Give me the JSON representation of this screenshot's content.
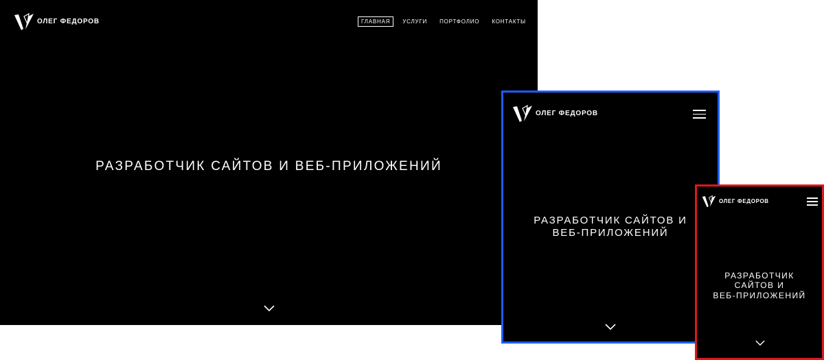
{
  "brand": {
    "name": "ОЛЕГ ФЕДОРОВ",
    "logo_icon": "logo-mark-icon"
  },
  "nav": {
    "items": [
      {
        "label": "ГЛАВНАЯ",
        "active": true
      },
      {
        "label": "УСЛУГИ",
        "active": false
      },
      {
        "label": "ПОРТФОЛИО",
        "active": false
      },
      {
        "label": "КОНТАКТЫ",
        "active": false
      }
    ]
  },
  "hero": {
    "desktop_title": "РАЗРАБОТЧИК САЙТОВ И ВЕБ-ПРИЛОЖЕНИЙ",
    "tablet_title": "РАЗРАБОТЧИК САЙТОВ И\nВЕБ-ПРИЛОЖЕНИЙ",
    "mobile_title": "РАЗРАБОТЧИК\nСАЙТОВ И\nВЕБ-ПРИЛОЖЕНИЙ",
    "scroll_icon": "chevron-down-icon"
  },
  "menu_icon": "hamburger-menu-icon",
  "colors": {
    "page_background": "#ffffff",
    "screen_background": "#000000",
    "text": "#ffffff",
    "tablet_frame": "#1f5cff",
    "mobile_frame": "#e01818"
  }
}
